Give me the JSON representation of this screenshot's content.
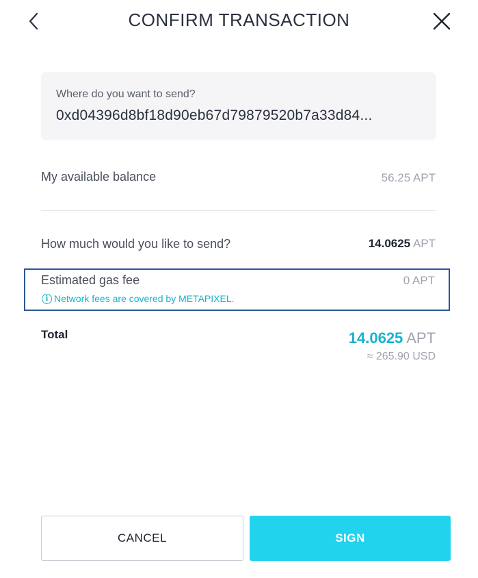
{
  "header": {
    "title": "CONFIRM TRANSACTION",
    "back_icon": "chevron-left-icon",
    "close_icon": "close-icon"
  },
  "recipient": {
    "label": "Where do you want to send?",
    "address": "0xd04396d8bf18d90eb67d79879520b7a33d84..."
  },
  "balance": {
    "label": "My available balance",
    "value": "56.25 APT"
  },
  "amount": {
    "label": "How much would you like to send?",
    "value": "14.0625",
    "unit": "APT"
  },
  "gas": {
    "label": "Estimated gas fee",
    "value": "0 APT",
    "note": "Network fees are covered by METAPIXEL.",
    "note_icon": "info-icon"
  },
  "total": {
    "label": "Total",
    "amount": "14.0625",
    "unit": "APT",
    "usd": "≈ 265.90 USD"
  },
  "actions": {
    "cancel_label": "CANCEL",
    "sign_label": "SIGN"
  },
  "colors": {
    "accent": "#22d3ee",
    "highlight_border": "#2f5597",
    "muted_text": "#9ea3ad"
  }
}
